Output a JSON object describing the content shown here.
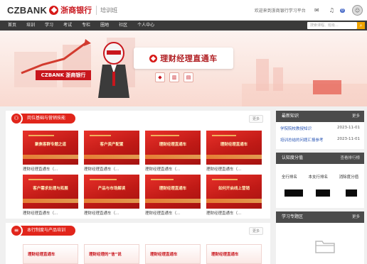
{
  "header": {
    "brand_en": "CZBANK",
    "brand_cn": "浙商银行",
    "site_name": "培训班",
    "right_link": "欢迎来到浙商银行学习平台",
    "notify_count": "0"
  },
  "nav": {
    "items": [
      "首页",
      "培训",
      "学习",
      "考试",
      "专栏",
      "圈地",
      "社区",
      "个人中心"
    ],
    "search_placeholder": "搜索课程、班级..."
  },
  "banner": {
    "title": "理财经理直通车",
    "logo_text": "CZBANK 浙商银行"
  },
  "section1": {
    "title": "岗位基础与营销技能",
    "more": "更多",
    "cards": [
      {
        "thumb": "聚焦客群专题之道",
        "caption": "理财经理直通车（..."
      },
      {
        "thumb": "客户资产配置",
        "caption": "理财经理直通车（..."
      },
      {
        "thumb": "理财经理直通车",
        "caption": "理财经理直通车（..."
      },
      {
        "thumb": "理财经理直通车",
        "caption": "理财经理直通车（..."
      },
      {
        "thumb": "客户需求处理与拓展",
        "caption": "理财经理直通车（..."
      },
      {
        "thumb": "产品与市场解读",
        "caption": "理财经理直通车（..."
      },
      {
        "thumb": "理财经理直通车",
        "caption": "理财经理直通车（..."
      },
      {
        "thumb": "如何开启线上营销",
        "caption": "理财经理直通车（..."
      }
    ]
  },
  "section2": {
    "title": "本行制度与产品培训",
    "more": "更多",
    "cards": [
      {
        "thumb": "理财经理直通车"
      },
      {
        "thumb": "理财经理的“信”说"
      },
      {
        "thumb": "理财经理直通车"
      },
      {
        "thumb": "理财经理直通车"
      }
    ]
  },
  "side_news": {
    "title": "最新知识",
    "more": "更多",
    "items": [
      {
        "title": "学院院校教授知识",
        "date": "2023-11-01"
      },
      {
        "title": "培训总结的问题汇报参考",
        "date": "2023-11-01"
      }
    ]
  },
  "side_rank": {
    "title": "认知度分值",
    "more": "查看排行榜",
    "cols": [
      "全行排名",
      "本支行排名",
      "消除度分值"
    ]
  },
  "side_study": {
    "title": "学习专题区",
    "more": "更多"
  },
  "colors": {
    "brand_red": "#e1251b",
    "nav_dark": "#3a3a3a",
    "search_orange": "#f0a400",
    "link_blue": "#2a56b5"
  }
}
